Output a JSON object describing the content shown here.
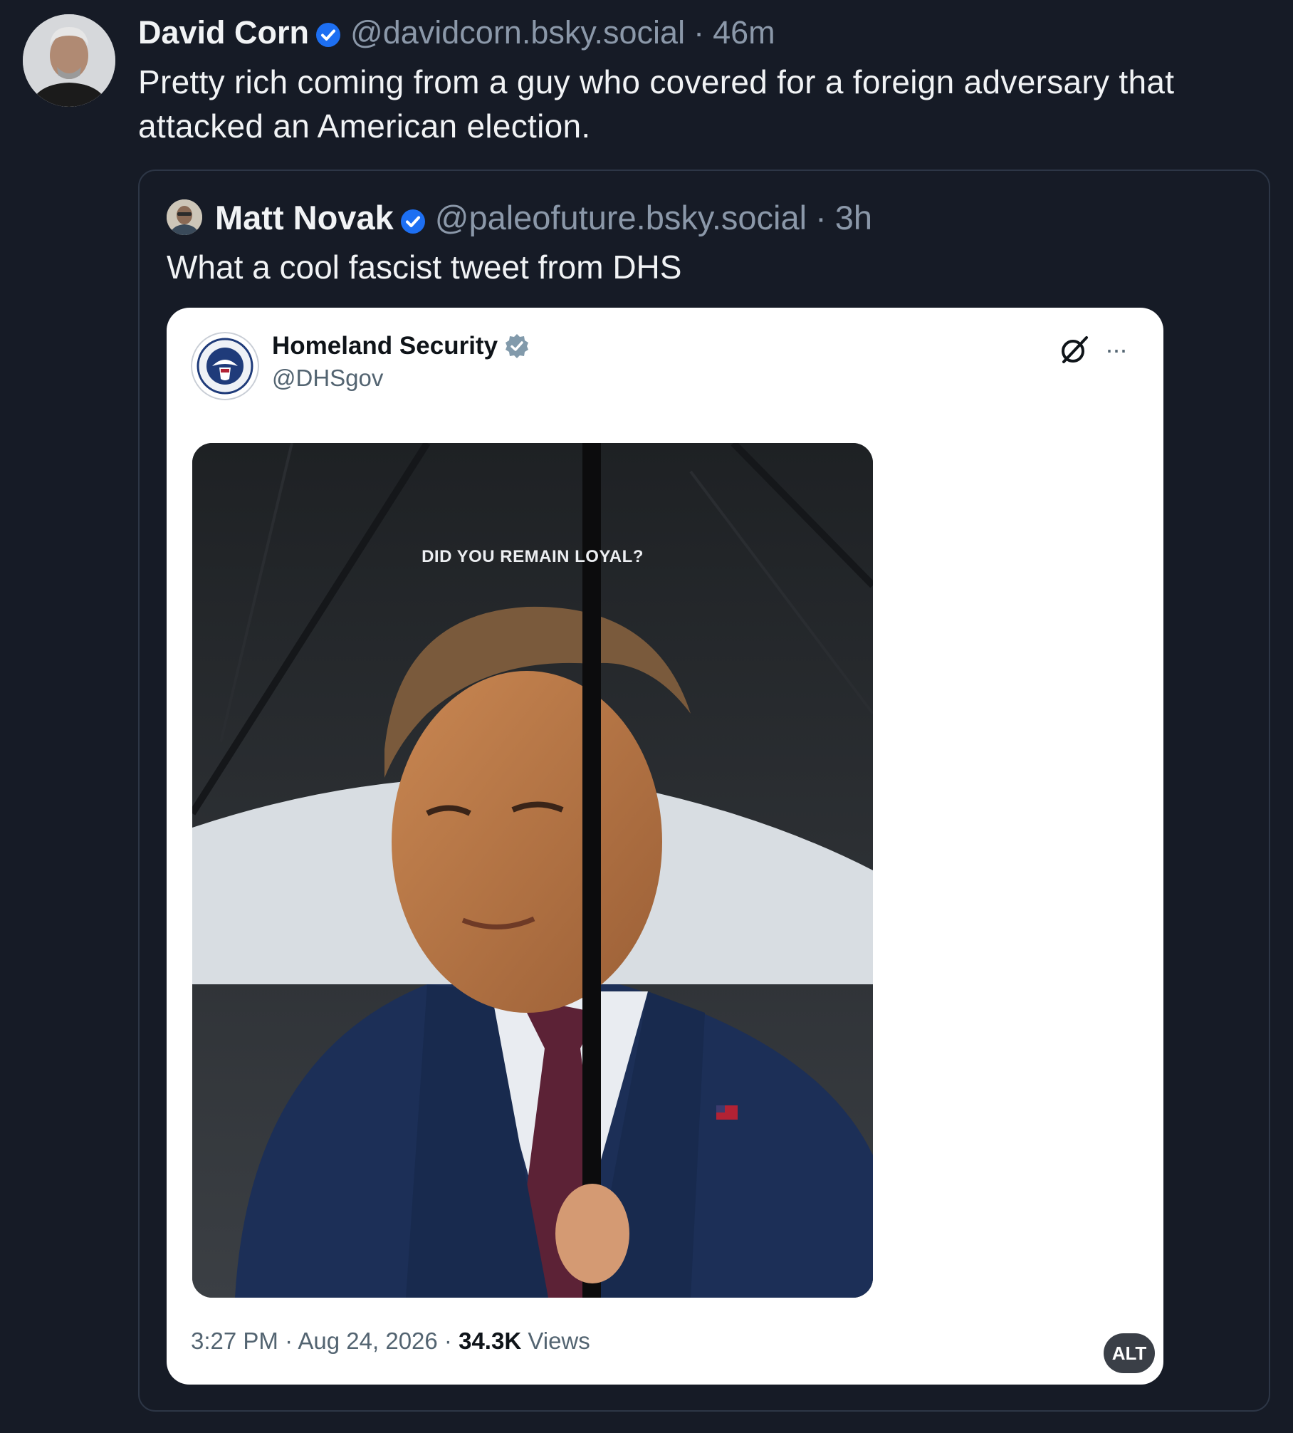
{
  "post": {
    "author_name": "David Corn",
    "handle": "@davidcorn.bsky.social",
    "separator": "·",
    "time": "46m",
    "text": "Pretty rich coming from a guy who covered for a foreign adversary that attacked an American election.",
    "verified_icon": "verified-check-icon"
  },
  "quote": {
    "author_name": "Matt Novak",
    "handle": "@paleofuture.bsky.social",
    "separator": "·",
    "time": "3h",
    "text": "What a cool fascist tweet from DHS"
  },
  "embed": {
    "account_name": "Homeland Security",
    "account_handle": "@DHSgov",
    "more_glyph": "···",
    "photo_caption": "DID YOU REMAIN LOYAL?",
    "time": "3:27 PM",
    "date_sep": " · ",
    "date": "Aug 24, 2026",
    "views_count": "34.3K",
    "views_label": " Views",
    "alt_label": "ALT",
    "colors": {
      "background": "#161b26",
      "accent_blue": "#1d6ff2",
      "muted_text": "#8b98a9"
    }
  }
}
